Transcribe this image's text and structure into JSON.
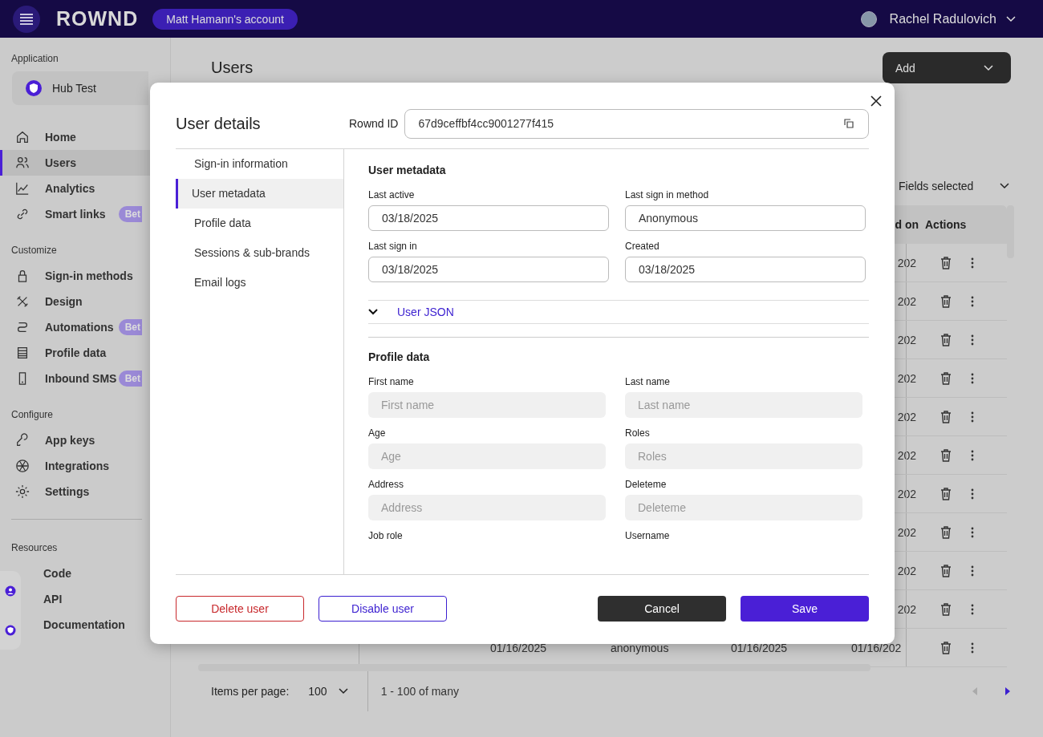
{
  "topbar": {
    "logo": "ROWND",
    "account": "Matt Hamann's account",
    "user": "Rachel Radulovich"
  },
  "sidebar": {
    "app_label": "Application",
    "app_name": "Hub Test",
    "sections": [
      {
        "items": [
          {
            "label": "Home",
            "selected": false
          },
          {
            "label": "Users",
            "selected": true
          },
          {
            "label": "Analytics",
            "selected": false
          },
          {
            "label": "Smart links",
            "selected": false,
            "badge": "Bet"
          }
        ]
      },
      {
        "heading": "Customize",
        "items": [
          {
            "label": "Sign-in methods",
            "selected": false
          },
          {
            "label": "Design",
            "selected": false
          },
          {
            "label": "Automations",
            "selected": false,
            "badge": "Bet"
          },
          {
            "label": "Profile data",
            "selected": false
          },
          {
            "label": "Inbound SMS",
            "selected": false,
            "badge": "Bet"
          }
        ]
      },
      {
        "heading": "Configure",
        "items": [
          {
            "label": "App keys",
            "selected": false
          },
          {
            "label": "Integrations",
            "selected": false
          },
          {
            "label": "Settings",
            "selected": false
          }
        ]
      },
      {
        "heading": "Resources",
        "items": [
          {
            "label": "Code",
            "selected": false
          },
          {
            "label": "API",
            "selected": false
          },
          {
            "label": "Documentation",
            "selected": false
          }
        ]
      }
    ]
  },
  "main": {
    "title": "Users",
    "add_button": "Add",
    "fields_select": "Fields selected",
    "table": {
      "columns": [
        {
          "label": "d on"
        },
        {
          "label": "Actions"
        }
      ],
      "rows": [
        {
          "cells": [
            "202"
          ]
        },
        {
          "cells": [
            "202"
          ]
        },
        {
          "cells": [
            "202"
          ]
        },
        {
          "cells": [
            "202"
          ]
        },
        {
          "cells": [
            "202"
          ]
        },
        {
          "cells": [
            "202"
          ]
        },
        {
          "cells": [
            "202"
          ]
        },
        {
          "cells": [
            "202"
          ]
        },
        {
          "cells": [
            "202"
          ]
        },
        {
          "cells": [
            "202"
          ]
        },
        {
          "cells": [
            "01/16/2025",
            "anonymous",
            "01/16/2025",
            "01/16/202"
          ]
        }
      ]
    },
    "pagination": {
      "items_label": "Items per page:",
      "per_page": "100",
      "range": "1 - 100 of many",
      "prev_disabled": true,
      "next_disabled": false
    }
  },
  "modal": {
    "title": "User details",
    "id_label": "Rownd ID",
    "id_value": "67d9ceffbf4cc9001277f415",
    "tabs": [
      {
        "label": "Sign-in information",
        "selected": false
      },
      {
        "label": "User metadata",
        "selected": true
      },
      {
        "label": "Profile data",
        "selected": false
      },
      {
        "label": "Sessions & sub-brands",
        "selected": false
      },
      {
        "label": "Email logs",
        "selected": false
      }
    ],
    "metadata": {
      "title": "User metadata",
      "fields": [
        {
          "label": "Last active",
          "value": "03/18/2025"
        },
        {
          "label": "Last sign in method",
          "value": "Anonymous"
        },
        {
          "label": "Last sign in",
          "value": "03/18/2025"
        },
        {
          "label": "Created",
          "value": "03/18/2025"
        }
      ]
    },
    "json_toggle": "User JSON",
    "profile": {
      "title": "Profile data",
      "fields": [
        {
          "label": "First name",
          "placeholder": "First name"
        },
        {
          "label": "Last name",
          "placeholder": "Last name"
        },
        {
          "label": "Age",
          "placeholder": "Age"
        },
        {
          "label": "Roles",
          "placeholder": "Roles"
        },
        {
          "label": "Address",
          "placeholder": "Address"
        },
        {
          "label": "Deleteme",
          "placeholder": "Deleteme"
        },
        {
          "label": "Job role"
        },
        {
          "label": "Username"
        }
      ]
    },
    "buttons": [
      {
        "label": "Delete user",
        "kind": "danger"
      },
      {
        "label": "Disable user",
        "kind": "outline"
      },
      {
        "label": "Cancel",
        "kind": "dark"
      },
      {
        "label": "Save",
        "kind": "primary"
      }
    ]
  }
}
